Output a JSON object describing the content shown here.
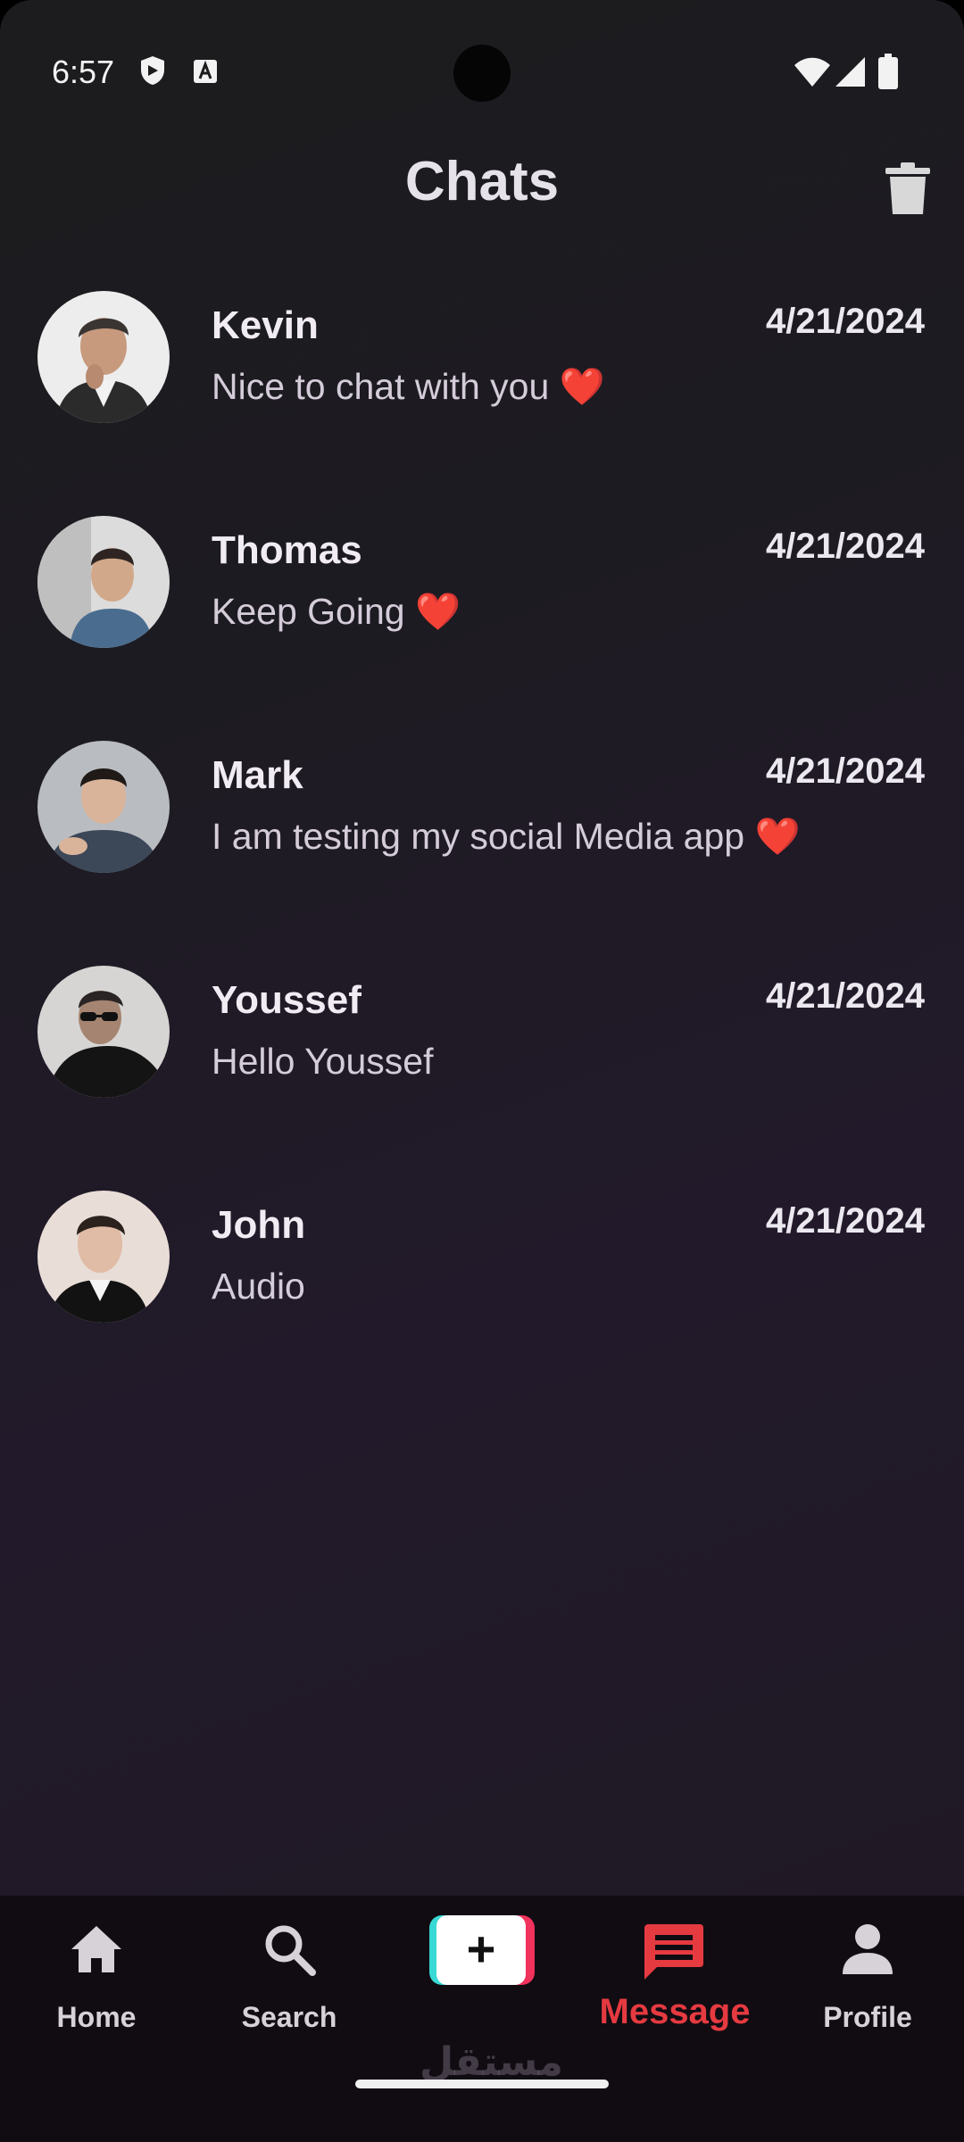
{
  "status_bar": {
    "time": "6:57"
  },
  "header": {
    "title": "Chats"
  },
  "chats": [
    {
      "name": "Kevin",
      "date": "4/21/2024",
      "message": "Nice to chat with you",
      "emoji": "❤️"
    },
    {
      "name": "Thomas",
      "date": "4/21/2024",
      "message": "Keep Going",
      "emoji": "❤️"
    },
    {
      "name": "Mark",
      "date": "4/21/2024",
      "message": "I am testing my social Media app",
      "emoji": "❤️"
    },
    {
      "name": "Youssef",
      "date": "4/21/2024",
      "message": "Hello Youssef",
      "emoji": ""
    },
    {
      "name": "John",
      "date": "4/21/2024",
      "message": "Audio",
      "emoji": ""
    }
  ],
  "bottom_nav": {
    "items": [
      {
        "label": "Home",
        "icon": "home-icon"
      },
      {
        "label": "Search",
        "icon": "search-icon"
      },
      {
        "label": "",
        "icon": "plus-icon",
        "glyph": "+"
      },
      {
        "label": "Message",
        "icon": "message-icon",
        "active": true
      },
      {
        "label": "Profile",
        "icon": "profile-icon"
      }
    ]
  },
  "watermark": "مستقل",
  "colors": {
    "accent": "#e53a40",
    "background": "#1d1b22",
    "nav_background": "#100c12",
    "plus_cyan": "#38d9d4",
    "plus_pink": "#f0325d"
  }
}
